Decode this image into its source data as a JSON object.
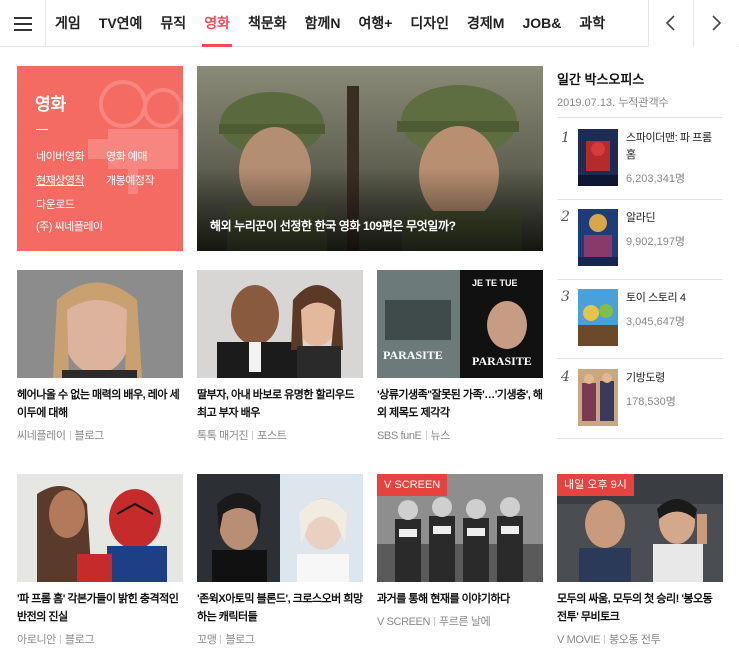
{
  "nav": {
    "tabs": [
      "게임",
      "TV연예",
      "뮤직",
      "영화",
      "책문화",
      "함께N",
      "여행+",
      "디자인",
      "경제M",
      "JOB&",
      "과학"
    ],
    "active_tab": "영화",
    "menu_icon": "hamburger-icon",
    "prev_icon": "chevron-left-icon",
    "next_icon": "chevron-right-icon"
  },
  "category": {
    "title": "영화",
    "color": "#f46b63",
    "links": [
      {
        "label": "네이버영화"
      },
      {
        "label": "영화 예매"
      },
      {
        "label": "현재상영작"
      },
      {
        "label": "개봉예정작"
      },
      {
        "label": "다운로드"
      },
      {
        "label": "(주) 씨네플레이"
      }
    ]
  },
  "hero": {
    "caption": "해외 누리꾼이 선정한 한국 영화 109편은 무엇일까?"
  },
  "box_office": {
    "title": "일간 박스오피스",
    "date": "2019.07.13. 누적관객수",
    "items": [
      {
        "rank": "1",
        "name": "스파이더맨: 파 프롬 홈",
        "count": "6,203,341명"
      },
      {
        "rank": "2",
        "name": "알라딘",
        "count": "9,902,197명"
      },
      {
        "rank": "3",
        "name": "토이 스토리 4",
        "count": "3,045,647명"
      },
      {
        "rank": "4",
        "name": "기방도령",
        "count": "178,530명"
      }
    ]
  },
  "cards": [
    {
      "title": "헤어나올 수 없는 매력의 배우, 레아 세이두에 대해",
      "source": "씨네플레이",
      "type": "블로그"
    },
    {
      "title": "딸부자, 아내 바보로 유명한 할리우드 최고 부자 배우",
      "source": "톡톡 매거진",
      "type": "포스트"
    },
    {
      "title": "'상류기생족''잘못된 가족'…'기생충', 해외 제목도 제각각",
      "source": "SBS funE",
      "type": "뉴스",
      "poster_text_1": "PARASITE",
      "poster_text_2": "PARASITE",
      "poster_tag": "JE TE TUE"
    },
    {
      "title": "'파 프롬 홈' 각본가들이 밝힌 충격적인 반전의 진실",
      "source": "아로니안",
      "type": "블로그"
    },
    {
      "title": "'존윅X아토믹 블론드', 크로스오버 희망하는 캐릭터들",
      "source": "꼬맹",
      "type": "블로그"
    },
    {
      "title": "과거를 통해 현재를 이야기하다",
      "source": "V SCREEN",
      "type": "푸르른 날에",
      "badge": "V SCREEN"
    },
    {
      "title": "모두의 싸움, 모두의 첫 승리! '봉오동 전투' 무비토크",
      "source": "V MOVIE",
      "type": "봉오동 전투",
      "badge": "내일 오후 9시"
    }
  ]
}
